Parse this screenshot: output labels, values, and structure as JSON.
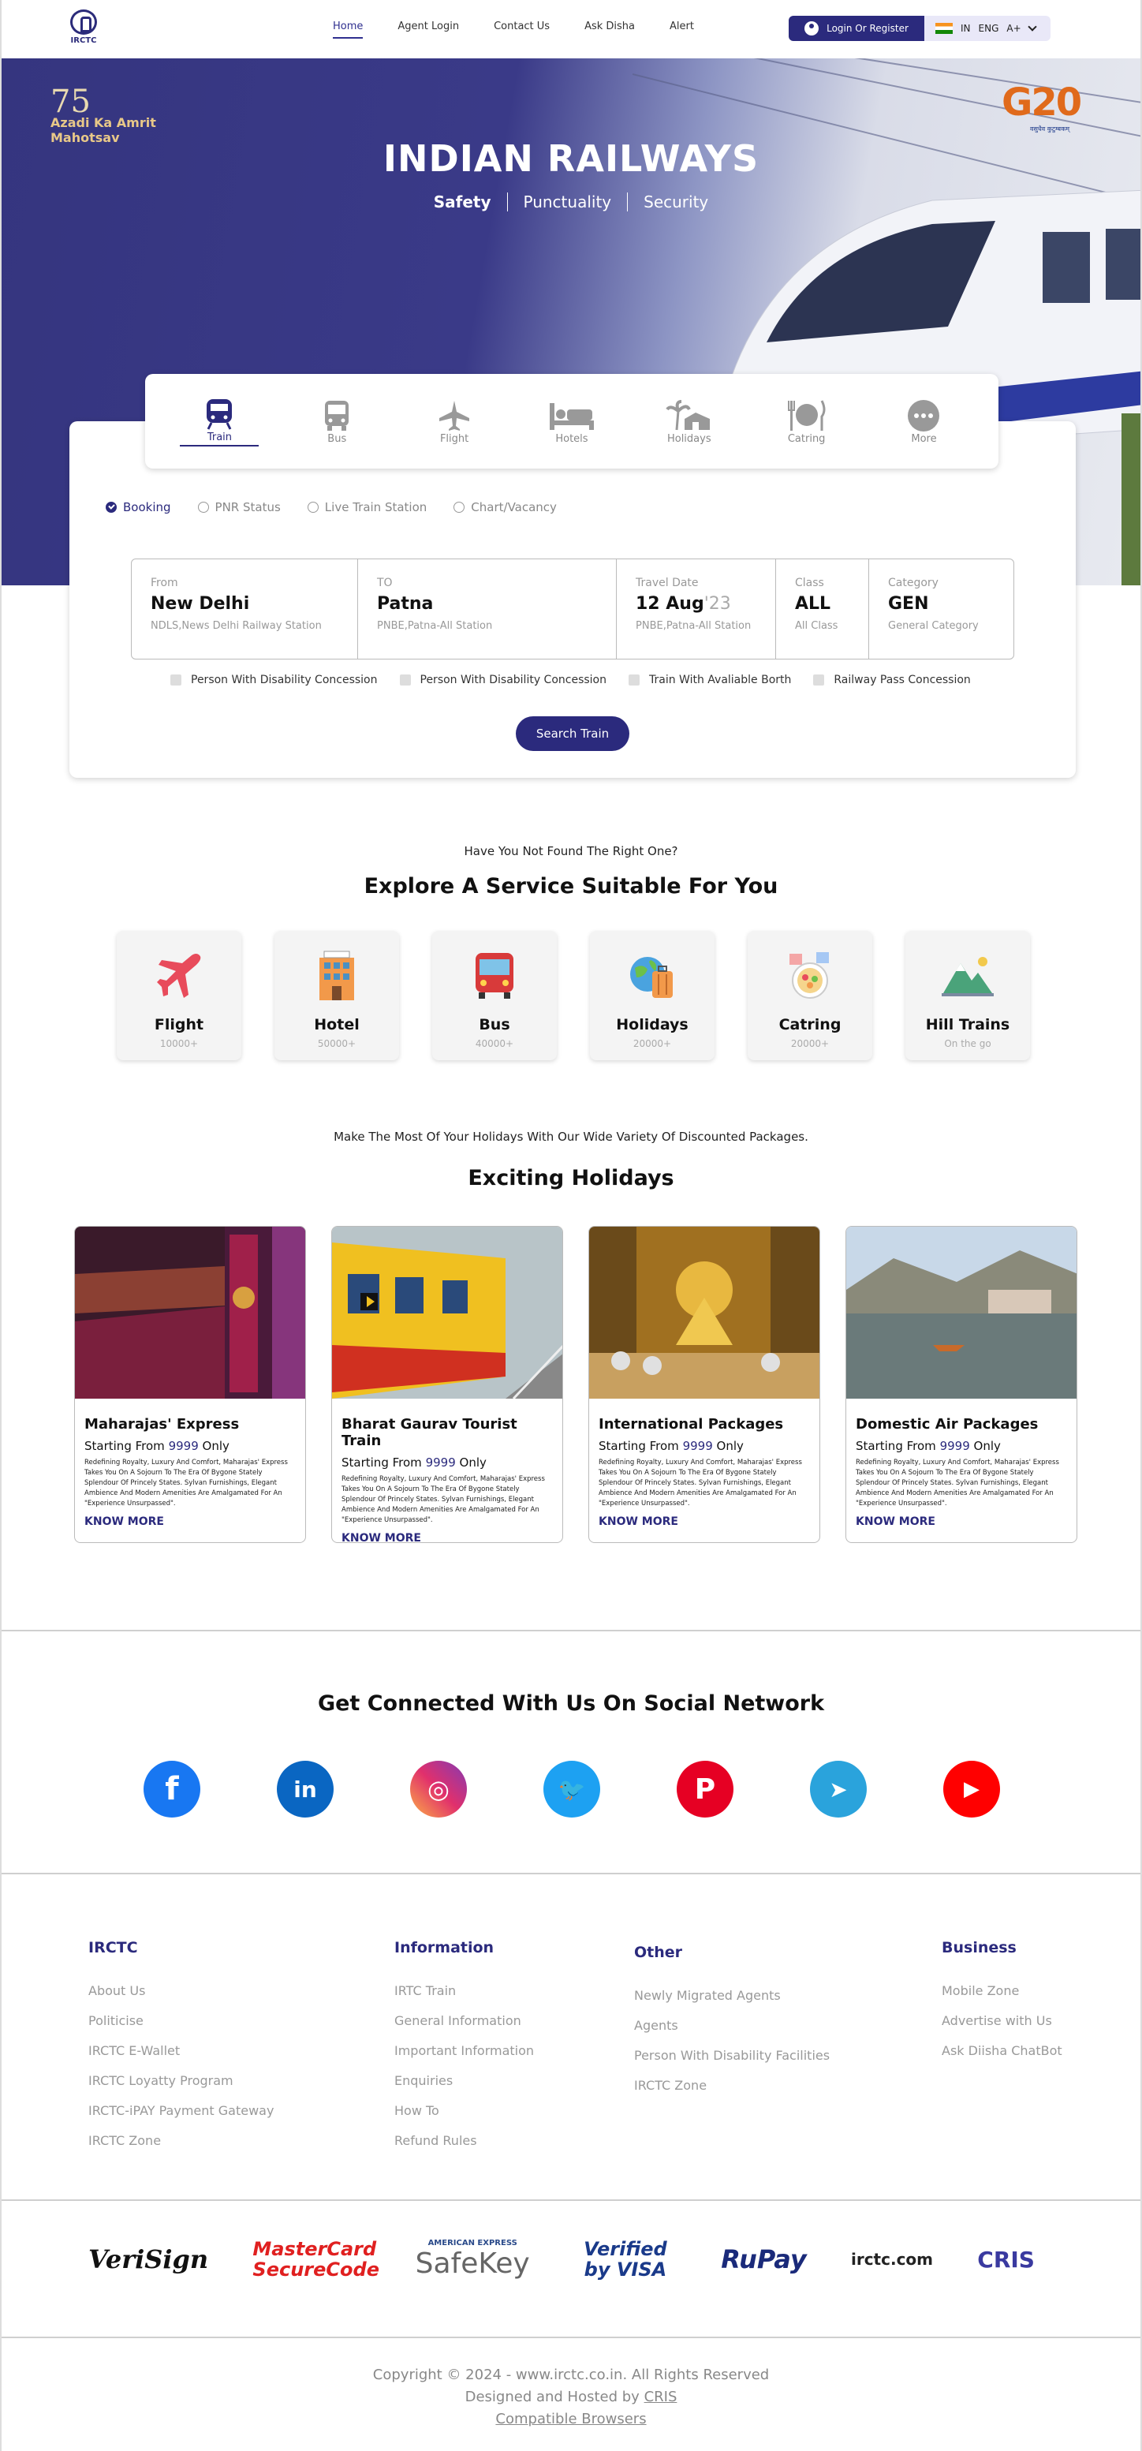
{
  "header": {
    "logo_text": "IRCTC",
    "nav": [
      "Home",
      "Agent Login",
      "Contact Us",
      "Ask Disha",
      "Alert"
    ],
    "login_label": "Login Or Register",
    "lang": "IN",
    "lang_code": "ENG",
    "font_size": "A+"
  },
  "hero": {
    "azadi_75": "75",
    "azadi_text": "Azadi Ka Amrit Mahotsav",
    "g20": "G20",
    "g20_sub": "वसुधैव कुटुम्बकम्",
    "title": "INDIAN RAILWAYS",
    "subtitles": [
      "Safety",
      "Punctuality",
      "Security"
    ]
  },
  "booking": {
    "tabs": [
      {
        "label": "Train",
        "icon": "train-icon"
      },
      {
        "label": "Bus",
        "icon": "bus-icon"
      },
      {
        "label": "Flight",
        "icon": "flight-icon"
      },
      {
        "label": "Hotels",
        "icon": "hotel-icon"
      },
      {
        "label": "Holidays",
        "icon": "holidays-icon"
      },
      {
        "label": "Catring",
        "icon": "catering-icon"
      },
      {
        "label": "More",
        "icon": "more-icon"
      }
    ],
    "radios": [
      "Booking",
      "PNR Status",
      "Live Train Station",
      "Chart/Vacancy"
    ],
    "from": {
      "label": "From",
      "value": "New Delhi",
      "sub": "NDLS,News Delhi Railway Station"
    },
    "to": {
      "label": "TO",
      "value": "Patna",
      "sub": "PNBE,Patna-All Station"
    },
    "date": {
      "label": "Travel Date",
      "value": "12 Aug",
      "year": "'23",
      "sub": "PNBE,Patna-All Station"
    },
    "class": {
      "label": "Class",
      "value": "ALL",
      "sub": "All Class"
    },
    "category": {
      "label": "Category",
      "value": "GEN",
      "sub": "General Category"
    },
    "checks": [
      "Person With Disability Concession",
      "Person With Disability Concession",
      "Train With Avaliable Borth",
      "Railway Pass Concession"
    ],
    "search_label": "Search Train"
  },
  "explore": {
    "pre": "Have You Not Found The Right One?",
    "title": "Explore A Service Suitable For You",
    "services": [
      {
        "name": "Flight",
        "count": "10000+"
      },
      {
        "name": "Hotel",
        "count": "50000+"
      },
      {
        "name": "Bus",
        "count": "40000+"
      },
      {
        "name": "Holidays",
        "count": "20000+"
      },
      {
        "name": "Catring",
        "count": "20000+"
      },
      {
        "name": "Hill Trains",
        "count": "On the go"
      }
    ]
  },
  "holidays": {
    "pre": "Make The Most Of Your Holidays With Our Wide Variety Of Discounted Packages.",
    "title": "Exciting Holidays",
    "starting": "Starting From",
    "price": "9999",
    "only": "Only",
    "desc": "Redefining Royalty, Luxury And Comfort, Maharajas' Express Takes You On A Sojourn To The Era Of Bygone Stately Splendour Of Princely States. Sylvan Furnishings, Elegant Ambience And Modern Amenities Are Amalgamated For An \"Experience Unsurpassed\".",
    "know_more": "KNOW MORE",
    "cards": [
      {
        "title": "Maharajas' Express"
      },
      {
        "title": "Bharat Gaurav Tourist Train"
      },
      {
        "title": "International Packages"
      },
      {
        "title": "Domestic Air Packages"
      }
    ]
  },
  "social": {
    "title": "Get Connected With Us On Social Network",
    "items": [
      {
        "name": "facebook",
        "glyph": "f",
        "color": "#1877f2"
      },
      {
        "name": "linkedin",
        "glyph": "in",
        "color": "#0a66c2"
      },
      {
        "name": "instagram",
        "glyph": "◎",
        "color": "#e1306c"
      },
      {
        "name": "twitter",
        "glyph": "🐦",
        "color": "#1da1f2"
      },
      {
        "name": "pinterest",
        "glyph": "P",
        "color": "#e60023"
      },
      {
        "name": "telegram",
        "glyph": "➤",
        "color": "#2aa3dc"
      },
      {
        "name": "youtube",
        "glyph": "▶",
        "color": "#ff0000"
      }
    ]
  },
  "footer": {
    "cols": [
      {
        "title": "IRCTC",
        "links": [
          "About Us",
          "Politicise",
          "IRCTC E-Wallet",
          "IRCTC Loyatty Program",
          "IRCTC-iPAY Payment Gateway",
          "IRCTC Zone"
        ]
      },
      {
        "title": "Information",
        "links": [
          "IRTC Train",
          "General Information",
          "Important Information",
          "Enquiries",
          "How To",
          "Refund Rules"
        ]
      },
      {
        "title": "Other",
        "links": [
          "Newly Migrated Agents",
          "Agents",
          "Person With Disability Facilities",
          "IRCTC Zone"
        ]
      },
      {
        "title": "Business",
        "links": [
          "Mobile Zone",
          "Advertise with Us",
          "Ask Diisha ChatBot"
        ]
      }
    ],
    "payments": [
      "VeriSign",
      "MasterCard SecureCode",
      "SafeKey",
      "Verified by VISA",
      "RuPay",
      "irctc.com",
      "CRIS"
    ],
    "amex": "AMERICAN EXPRESS",
    "copyright": "Copyright © 2024 - www.irctc.co.in. All Rights Reserved",
    "hosted": "Designed and Hosted by",
    "cris": "CRIS",
    "browsers": "Compatible Browsers"
  }
}
